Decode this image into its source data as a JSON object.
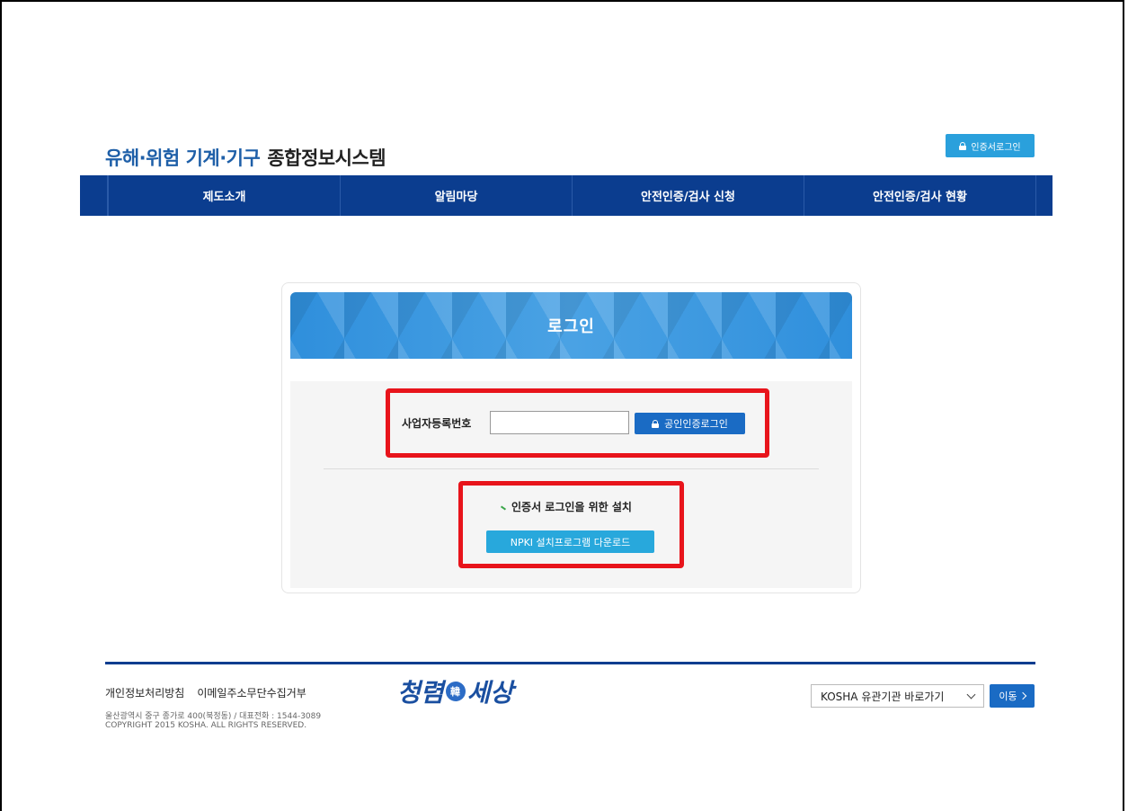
{
  "header": {
    "title_blue": "유해·위험 기계·기구",
    "title_dark": "종합정보시스템",
    "cert_login_label": "인증서로그인"
  },
  "nav": {
    "items": [
      "제도소개",
      "알림마당",
      "안전인증/검사 신청",
      "안전인증/검사 현황"
    ]
  },
  "login": {
    "banner_title": "로그인",
    "biz_number_label": "사업자등록번호",
    "biz_number_value": "",
    "pki_login_label": "공인인증로그인",
    "install_title": "인증서 로그인을 위한 설치",
    "npki_download_label": "NPKI 설치프로그램 다운로드"
  },
  "footer": {
    "links": [
      "개인정보처리방침",
      "이메일주소무단수집거부"
    ],
    "address": "울산광역시 중구 종가로 400(북정동) / 대표전화 : 1544-3089",
    "copyright": "COPYRIGHT 2015 KOSHA. ALL RIGHTS RESERVED.",
    "logo_text_left": "청렴",
    "logo_seal": "韓",
    "logo_text_right": "세상",
    "site_select_value": "KOSHA 유관기관 바로가기",
    "go_label": "이동"
  },
  "colors": {
    "nav_bg": "#0b3d8f",
    "accent_blue": "#1a6bc4",
    "light_blue": "#28a8dc",
    "highlight_red": "#e8141b"
  }
}
